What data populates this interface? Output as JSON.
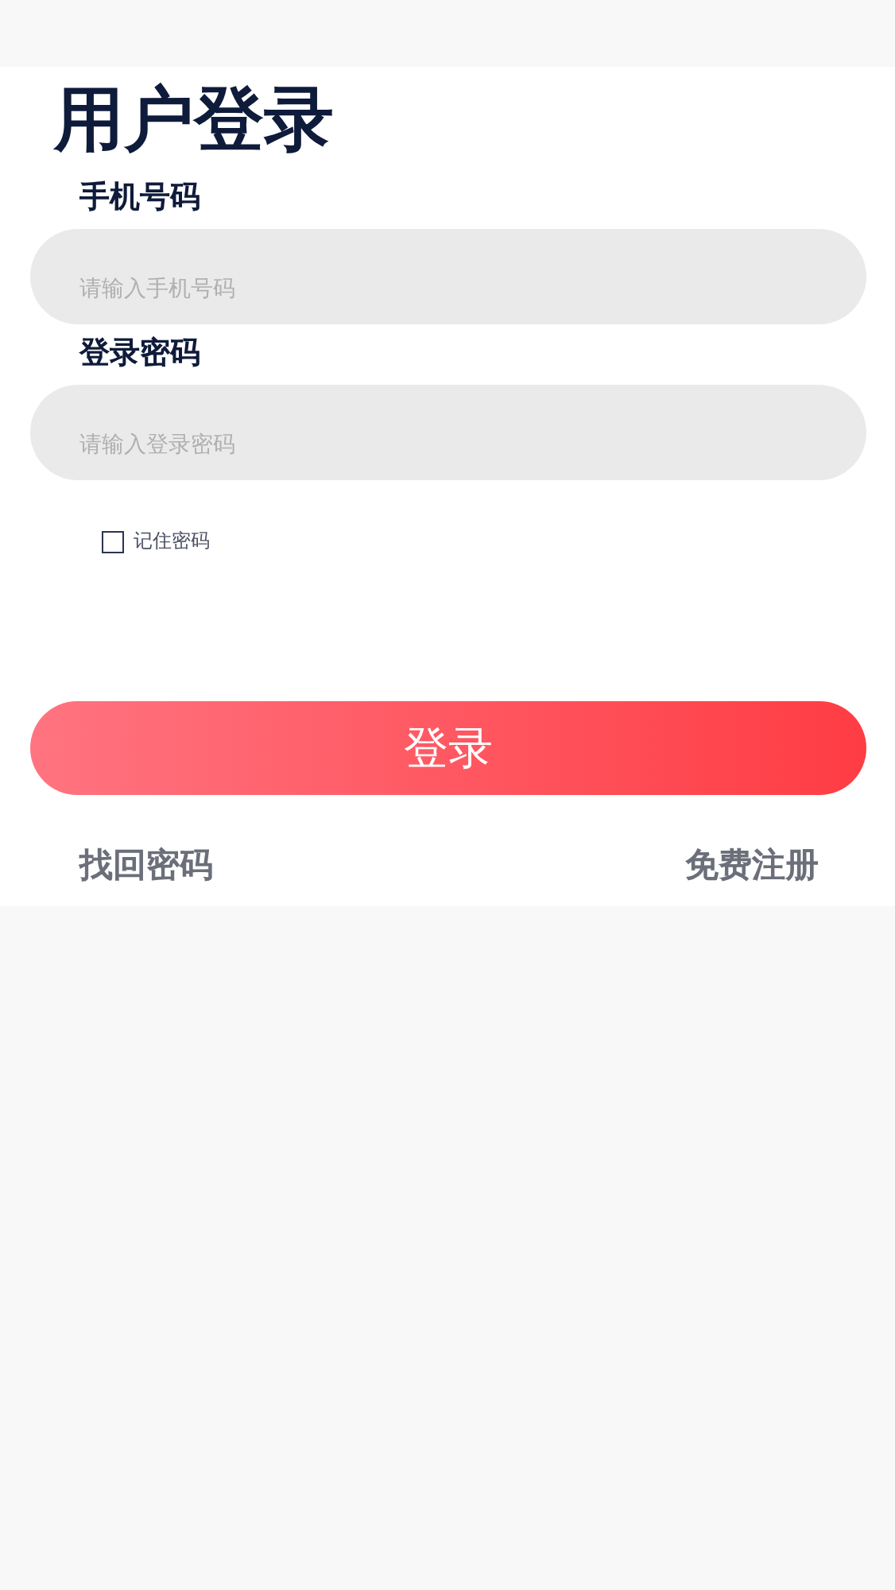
{
  "title": "用户登录",
  "fields": [
    {
      "label": "手机号码",
      "placeholder": "请输入手机号码"
    },
    {
      "label": "登录密码",
      "placeholder": "请输入登录密码"
    }
  ],
  "remember": {
    "label": "记住密码",
    "checked": false
  },
  "login_button": "登录",
  "links": [
    "找回密码",
    "免费注册"
  ]
}
